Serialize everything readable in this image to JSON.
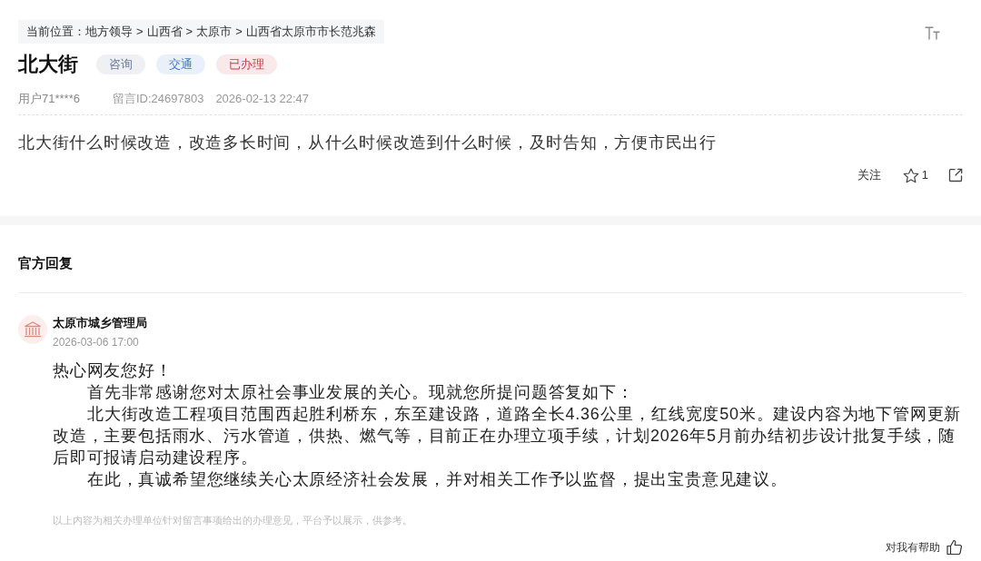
{
  "breadcrumb": {
    "prefix": "当前位置：",
    "items": [
      {
        "kind": "link",
        "text": "地方领导"
      },
      {
        "kind": "separator",
        "text": ">"
      },
      {
        "kind": "link",
        "text": "山西省"
      },
      {
        "kind": "separator",
        "text": ">"
      },
      {
        "kind": "link",
        "text": "太原市"
      },
      {
        "kind": "separator",
        "text": ">"
      },
      {
        "kind": "link",
        "text": "山西省太原市市长范兆森"
      }
    ]
  },
  "question": {
    "title": "北大街",
    "tags": [
      {
        "text": "咨询",
        "color": "#6b7a99"
      },
      {
        "text": "交通",
        "color": "#3b73c9"
      },
      {
        "text": "已办理",
        "color": "#d4373f"
      }
    ],
    "user": "用户71****6",
    "message_id": "留言ID:24697803",
    "time": "2026-02-13 22:47",
    "body": "北大街什么时候改造，改造多长时间，从什么时候改造到什么时候，及时告知，方便市民出行",
    "follow": "关注",
    "likes": "1"
  },
  "reply": {
    "heading": "官方回复",
    "agency": "太原市城乡管理局",
    "time": "2026-03-06 17:00",
    "paragraphs": [
      {
        "text": "热心网友您好！",
        "indented": false
      },
      {
        "text": "首先非常感谢您对太原社会事业发展的关心。现就您所提问题答复如下：",
        "indented": true
      },
      {
        "text": "北大街改造工程项目范围西起胜利桥东，东至建设路，道路全长4.36公里，红线宽度50米。建设内容为地下管网更新改造，主要包括雨水、污水管道，供热、燃气等，目前正在办理立项手续，计划2026年5月前办结初步设计批复手续，随后即可报请启动建设程序。",
        "indented": true
      },
      {
        "text": "在此，真诚希望您继续关心太原经济社会发展，并对相关工作予以监督，提出宝贵意见建议。",
        "indented": true
      }
    ],
    "disclaimer": "以上内容为相关办理单位针对留言事项给出的办理意见，平台予以展示，供参考。",
    "helpful": "对我有帮助"
  }
}
